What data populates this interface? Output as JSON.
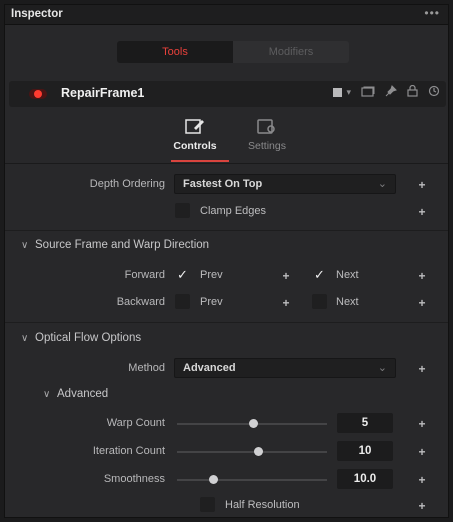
{
  "panel": {
    "title": "Inspector",
    "menu_glyph": "•••"
  },
  "mode_tabs": {
    "tools": "Tools",
    "modifiers": "Modifiers"
  },
  "tool": {
    "name": "RepairFrame1",
    "color_glyph": "▾"
  },
  "subtabs": {
    "controls": "Controls",
    "settings": "Settings"
  },
  "depth_ordering": {
    "label": "Depth Ordering",
    "value": "Fastest On Top",
    "clamp_edges": {
      "label": "Clamp Edges",
      "checked": false
    }
  },
  "source_section": {
    "title": "Source Frame and Warp Direction",
    "forward": {
      "label": "Forward",
      "prev": {
        "label": "Prev",
        "checked": true
      },
      "next": {
        "label": "Next",
        "checked": true
      }
    },
    "backward": {
      "label": "Backward",
      "prev": {
        "label": "Prev",
        "checked": false
      },
      "next": {
        "label": "Next",
        "checked": false
      }
    }
  },
  "optical_flow": {
    "title": "Optical Flow Options",
    "method": {
      "label": "Method",
      "value": "Advanced"
    },
    "advanced": {
      "title": "Advanced",
      "warp_count": {
        "label": "Warp Count",
        "value": "5"
      },
      "iteration_count": {
        "label": "Iteration Count",
        "value": "10"
      },
      "smoothness": {
        "label": "Smoothness",
        "value": "10.0"
      },
      "half_resolution": {
        "label": "Half Resolution",
        "checked": false
      }
    }
  },
  "glyphs": {
    "plus": "+",
    "check": "✓",
    "chevron_down": "⌄",
    "section_chevron": "∨"
  },
  "colors": {
    "accent_red": "#e8413b",
    "panel_bg": "#28282a",
    "field_bg": "#1f1f20"
  }
}
